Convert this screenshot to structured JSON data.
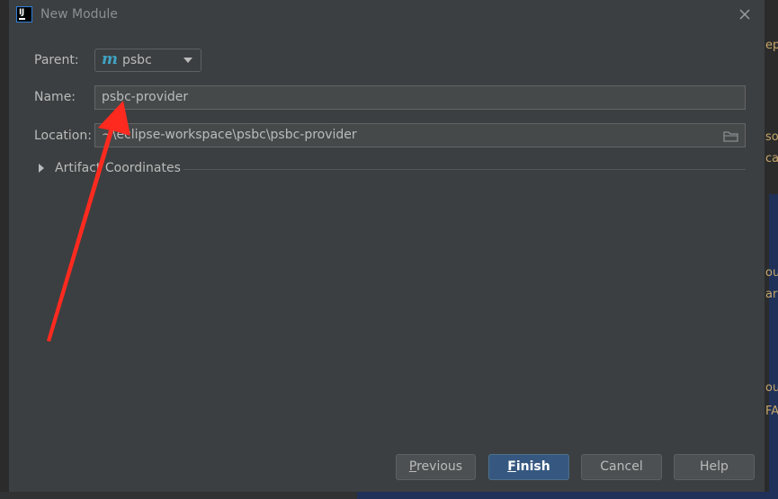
{
  "window": {
    "title": "New Module",
    "app_icon_text": "IJ"
  },
  "form": {
    "parent_label": "Parent:",
    "parent_value": "psbc",
    "parent_icon": "maven-module-icon",
    "name_label": "Name:",
    "name_value": "psbc-provider",
    "location_label": "Location:",
    "location_value": "~\\eclipse-workspace\\psbc\\psbc-provider",
    "section_title": "Artifact Coordinates",
    "section_collapsed": true
  },
  "buttons": {
    "previous": {
      "mnemonic": "P",
      "rest": "revious"
    },
    "finish": {
      "mnemonic": "F",
      "rest": "inish"
    },
    "cancel": "Cancel",
    "help": "Help"
  },
  "background": {
    "fragments": [
      "ep",
      "so",
      "ca",
      "ou",
      "ar",
      "ou",
      "FA"
    ]
  },
  "annotation": {
    "color": "#ff2a1f",
    "kind": "red-arrow pointing at Name field"
  },
  "colors": {
    "dialog_bg": "#3c3f41",
    "field_bg": "#45494a",
    "primary_button": "#365880",
    "text": "#bbbbbb",
    "maven_icon": "#3fa3c4"
  }
}
